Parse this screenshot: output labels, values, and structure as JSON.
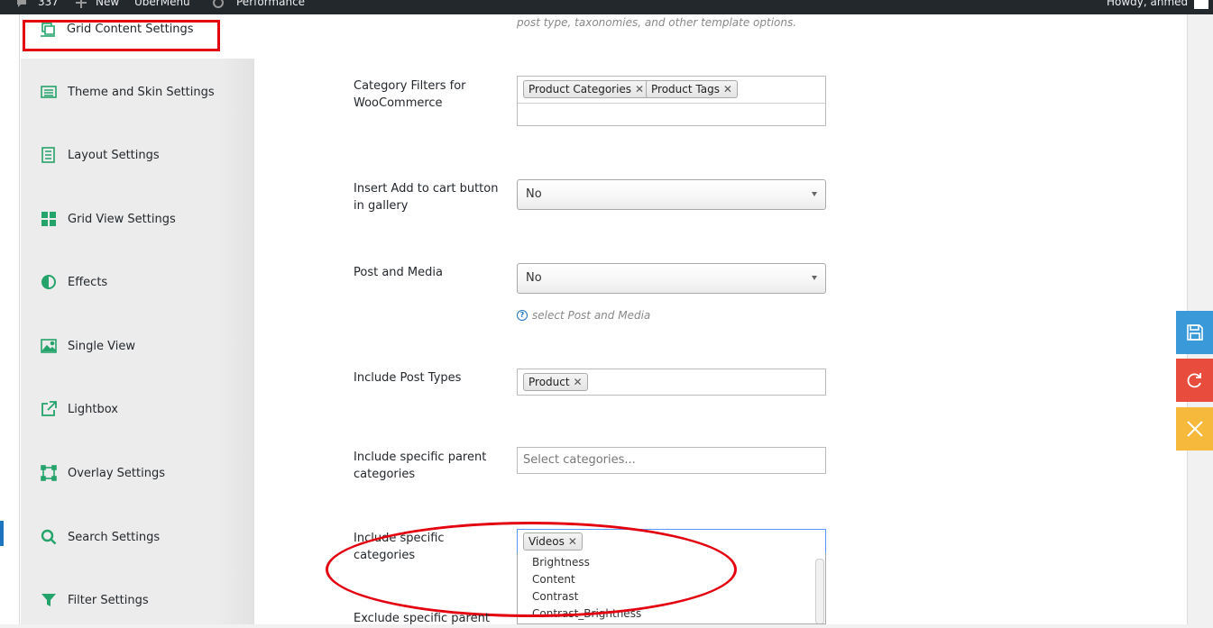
{
  "admin_bar": {
    "comments_count": "337",
    "new_label": "New",
    "ubermenu_label": "UberMenu",
    "performance_label": "Performance",
    "howdy_label": "Howdy, ahmed"
  },
  "sidebar": {
    "active_tab": {
      "label": "Grid Content Settings",
      "icon": "grid-content-icon"
    },
    "items": [
      {
        "label": "Theme and Skin Settings",
        "icon": "theme-skin-icon"
      },
      {
        "label": "Layout Settings",
        "icon": "layout-icon"
      },
      {
        "label": "Grid View Settings",
        "icon": "grid-view-icon"
      },
      {
        "label": "Effects",
        "icon": "effects-icon"
      },
      {
        "label": "Single View",
        "icon": "single-view-icon"
      },
      {
        "label": "Lightbox",
        "icon": "lightbox-icon"
      },
      {
        "label": "Overlay Settings",
        "icon": "overlay-icon"
      },
      {
        "label": "Search Settings",
        "icon": "search-icon"
      },
      {
        "label": "Filter Settings",
        "icon": "filter-icon"
      }
    ]
  },
  "main": {
    "top_description": "post type, taxonomies, and other template options.",
    "category_filters": {
      "label": "Category Filters for WooCommerce",
      "tags": [
        "Product Categories",
        "Product Tags"
      ]
    },
    "add_to_cart": {
      "label": "Insert Add to cart button in gallery",
      "value": "No"
    },
    "post_and_media": {
      "label": "Post and Media",
      "value": "No",
      "help": "select Post and Media"
    },
    "post_types": {
      "label": "Include Post Types",
      "tags": [
        "Product"
      ]
    },
    "parent_categories": {
      "label": "Include specific parent categories",
      "placeholder": "Select categories..."
    },
    "specific_categories": {
      "label": "Include specific categories",
      "tags": [
        "Videos"
      ],
      "options": [
        "Brightness",
        "Content",
        "Contrast",
        "Contrast_Brightness"
      ]
    },
    "exclude_parent": {
      "label": "Exclude specific parent"
    }
  },
  "colors": {
    "accent_green": "#24a36b",
    "annotation_red": "#e3000f",
    "save_blue": "#3a9ad9",
    "reset_red": "#e74c3c",
    "close_yellow": "#f6b93b"
  },
  "actions": {
    "save_icon": "save-icon",
    "reset_icon": "reset-icon",
    "close_icon": "close-icon"
  }
}
